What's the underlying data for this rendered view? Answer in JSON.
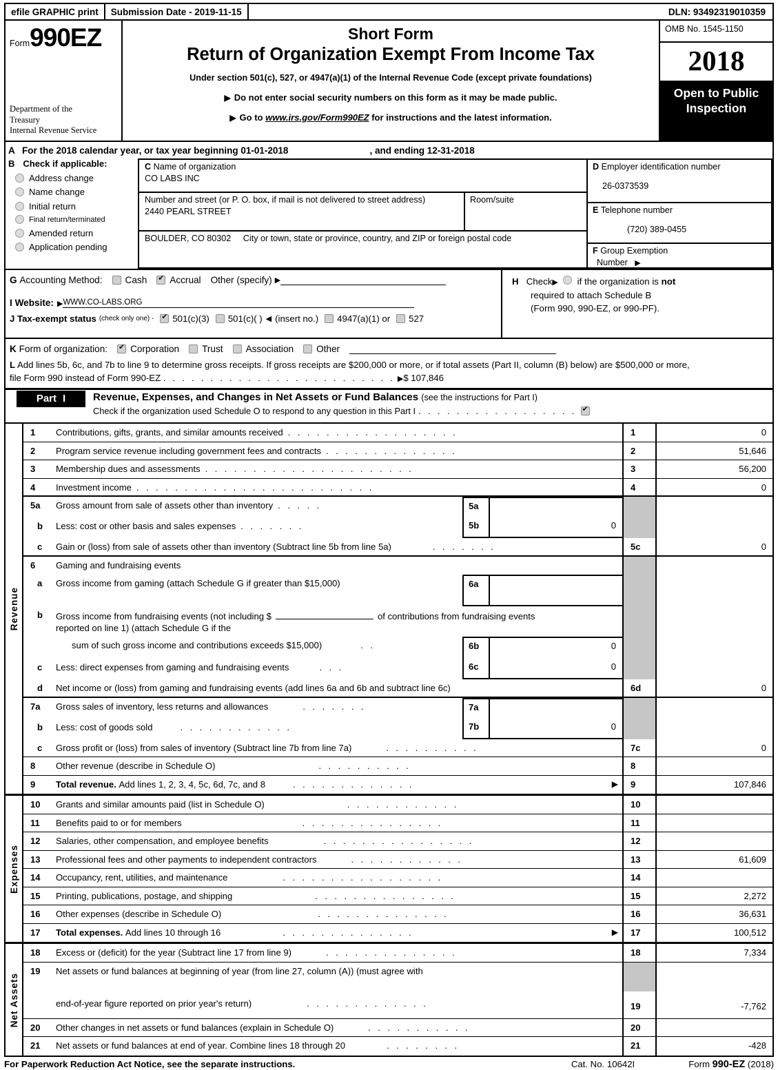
{
  "efile": {
    "print_label": "efile GRAPHIC print",
    "submission_date": "Submission Date - 2019-11-15",
    "dln": "DLN: 93492319010359"
  },
  "masthead": {
    "form_label": "Form",
    "form_number": "990EZ",
    "department": "Department of the\nTreasury\nInternal Revenue Service",
    "title_short": "Short Form",
    "title_main": "Return of Organization Exempt From Income Tax",
    "subtitle": "Under section 501(c), 527, or 4947(a)(1) of the Internal Revenue Code (except private foundations)",
    "bullet1": "Do not enter social security numbers on this form as it may be made public.",
    "bullet2_pre": "Go to ",
    "bullet2_link": "www.irs.gov/Form990EZ",
    "bullet2_post": " for instructions and the latest information.",
    "omb": "OMB No. 1545-1150",
    "year": "2018",
    "open_to_public": "Open to Public\nInspection"
  },
  "section_a": {
    "letter": "A",
    "text": "For the 2018 calendar year, or tax year beginning 01-01-2018",
    "ending": ", and ending 12-31-2018"
  },
  "section_b": {
    "letter": "B",
    "title": "Check if applicable:",
    "checkboxes": [
      {
        "label": "Address change",
        "checked": false
      },
      {
        "label": "Name change",
        "checked": false
      },
      {
        "label": "Initial return",
        "checked": false
      },
      {
        "label": "Final return/terminated",
        "checked": false,
        "small": true
      },
      {
        "label": "Amended return",
        "checked": false
      },
      {
        "label": "Application pending",
        "checked": false
      }
    ]
  },
  "section_c": {
    "letter": "C",
    "name_label": "Name of organization",
    "org_name": "CO LABS INC",
    "street_label": "Number and street (or P. O. box, if mail is not delivered to street address)",
    "street": "2440 PEARL STREET",
    "room_label": "Room/suite",
    "room": "",
    "city_value": "BOULDER, CO   80302",
    "city_label": "City or town, state or province, country, and ZIP or foreign postal code"
  },
  "section_d": {
    "letter": "D",
    "label": "Employer identification number",
    "value": "26-0373539"
  },
  "section_e": {
    "letter": "E",
    "label": "Telephone number",
    "value": "(720) 389-0455"
  },
  "section_f": {
    "letter": "F",
    "label": "Group Exemption",
    "label2": "Number",
    "value": ""
  },
  "section_g": {
    "letter": "G",
    "label": "Accounting Method:",
    "options": [
      {
        "label": "Cash",
        "checked": false
      },
      {
        "label": "Accrual",
        "checked": true
      }
    ],
    "other_label": "Other (specify)",
    "other_value": ""
  },
  "section_h": {
    "letter": "H",
    "check_label": "Check",
    "text1": "if the organization is ",
    "text1_bold": "not",
    "text2": "required to attach Schedule B",
    "text3": "(Form 990, 990-EZ, or 990-PF).",
    "checked": false
  },
  "section_i": {
    "letter": "I",
    "label": "Website:",
    "value": "WWW.CO-LABS.ORG"
  },
  "section_j": {
    "letter": "J",
    "label": "Tax-exempt status",
    "note": "(check only one) -",
    "options": [
      {
        "label": "501(c)(3)",
        "checked": true
      },
      {
        "label": "501(c)(  )",
        "checked": false,
        "insert": "(insert no.)"
      },
      {
        "label": "4947(a)(1) or",
        "checked": false
      },
      {
        "label": "527",
        "checked": false
      }
    ]
  },
  "section_k": {
    "letter": "K",
    "label": "Form of organization:",
    "options": [
      {
        "label": "Corporation",
        "checked": true
      },
      {
        "label": "Trust",
        "checked": false
      },
      {
        "label": "Association",
        "checked": false
      },
      {
        "label": "Other",
        "checked": false
      }
    ]
  },
  "section_l": {
    "letter": "L",
    "text1": "Add lines 5b, 6c, and 7b to line 9 to determine gross receipts. If gross receipts are $200,000 or more, or if total assets (Part II, column (B) below) are $500,000 or more,",
    "text2": "file Form 990 instead of Form 990-EZ",
    "amount_label": "$ 107,846"
  },
  "part1": {
    "tag": "Part",
    "roman": "I",
    "title": "Revenue, Expenses, and Changes in Net Assets or Fund Balances",
    "title_note": "(see the instructions for Part I)",
    "schedule_o_text": "Check if the organization used Schedule O to respond to any question in this Part I",
    "schedule_o_checked": true
  },
  "revenue": {
    "side_label": "Revenue",
    "rows": [
      {
        "num": "1",
        "desc": "Contributions, gifts, grants, and similar amounts received",
        "rnum": "1",
        "value": "0"
      },
      {
        "num": "2",
        "desc": "Program service revenue including government fees and contracts",
        "rnum": "2",
        "value": "51,646"
      },
      {
        "num": "3",
        "desc": "Membership dues and assessments",
        "rnum": "3",
        "value": "56,200"
      },
      {
        "num": "4",
        "desc": "Investment income",
        "rnum": "4",
        "value": "0"
      },
      {
        "num": "5a",
        "desc": "Gross amount from sale of assets other than inventory",
        "sub_num": "5a",
        "sub_value": ""
      },
      {
        "num": "b",
        "desc": "Less: cost or other basis and sales expenses",
        "sub_num": "5b",
        "sub_value": "0"
      },
      {
        "num": "c",
        "desc": "Gain or (loss) from sale of assets other than inventory (Subtract line 5b from line 5a)",
        "rnum": "5c",
        "value": "0"
      },
      {
        "num": "6",
        "desc": "Gaming and fundraising events"
      },
      {
        "num": "a",
        "desc": "Gross income from gaming (attach Schedule G if greater than $15,000)",
        "sub_num": "6a",
        "sub_value": ""
      },
      {
        "num": "b",
        "desc_pre": "Gross income from fundraising events (not including $",
        "desc_post": "of contributions from fundraising events",
        "desc_line2": "reported on line 1) (attach Schedule G if the"
      },
      {
        "num": "",
        "desc": "sum of such gross income and contributions exceeds $15,000)",
        "sub_num": "6b",
        "sub_value": "0"
      },
      {
        "num": "c",
        "desc": "Less: direct expenses from gaming and fundraising events",
        "sub_num": "6c",
        "sub_value": "0"
      },
      {
        "num": "d",
        "desc": "Net income or (loss) from gaming and fundraising events (add lines 6a and 6b and subtract line 6c)",
        "rnum": "6d",
        "value": "0"
      },
      {
        "num": "7a",
        "desc": "Gross sales of inventory, less returns and allowances",
        "sub_num": "7a",
        "sub_value": ""
      },
      {
        "num": "b",
        "desc": "Less: cost of goods sold",
        "sub_num": "7b",
        "sub_value": "0"
      },
      {
        "num": "c",
        "desc": "Gross profit or (loss) from sales of inventory (Subtract line 7b from line 7a)",
        "rnum": "7c",
        "value": "0"
      },
      {
        "num": "8",
        "desc": "Other revenue (describe in Schedule O)",
        "rnum": "8",
        "value": ""
      },
      {
        "num": "9",
        "desc_bold": "Total revenue.",
        "desc": "Add lines 1, 2, 3, 4, 5c, 6d, 7c, and 8",
        "rnum": "9",
        "value": "107,846"
      }
    ]
  },
  "expenses": {
    "side_label": "Expenses",
    "rows": [
      {
        "num": "10",
        "desc": "Grants and similar amounts paid (list in Schedule O)",
        "rnum": "10",
        "value": ""
      },
      {
        "num": "11",
        "desc": "Benefits paid to or for members",
        "rnum": "11",
        "value": ""
      },
      {
        "num": "12",
        "desc": "Salaries, other compensation, and employee benefits",
        "rnum": "12",
        "value": ""
      },
      {
        "num": "13",
        "desc": "Professional fees and other payments to independent contractors",
        "rnum": "13",
        "value": "61,609"
      },
      {
        "num": "14",
        "desc": "Occupancy, rent, utilities, and maintenance",
        "rnum": "14",
        "value": ""
      },
      {
        "num": "15",
        "desc": "Printing, publications, postage, and shipping",
        "rnum": "15",
        "value": "2,272"
      },
      {
        "num": "16",
        "desc": "Other expenses (describe in Schedule O)",
        "rnum": "16",
        "value": "36,631"
      },
      {
        "num": "17",
        "desc_bold": "Total expenses.",
        "desc": "Add lines 10 through 16",
        "rnum": "17",
        "value": "100,512"
      }
    ]
  },
  "net_assets": {
    "side_label": "Net Assets",
    "rows": [
      {
        "num": "18",
        "desc": "Excess or (deficit) for the year (Subtract line 17 from line 9)",
        "rnum": "18",
        "value": "7,334"
      },
      {
        "num": "19",
        "desc": "Net assets or fund balances at beginning of year (from line 27, column (A)) (must agree with",
        "rnum": "",
        "value": "",
        "grey": true
      },
      {
        "num": "",
        "desc": "end-of-year figure reported on prior year's return)",
        "rnum": "19",
        "value": "-7,762"
      },
      {
        "num": "20",
        "desc": "Other changes in net assets or fund balances (explain in Schedule O)",
        "rnum": "20",
        "value": ""
      },
      {
        "num": "21",
        "desc": "Net assets or fund balances at end of year. Combine lines 18 through 20",
        "rnum": "21",
        "value": "-428"
      }
    ]
  },
  "footer": {
    "notice": "For Paperwork Reduction Act Notice, see the separate instructions.",
    "cat": "Cat. No. 10642I",
    "form_pre": "Form ",
    "form_bold": "990-EZ",
    "form_post": " (2018)"
  }
}
